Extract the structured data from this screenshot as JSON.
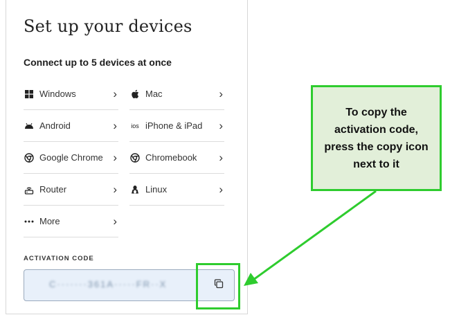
{
  "setup": {
    "title": "Set up your devices",
    "subtitle": "Connect up to 5 devices at once"
  },
  "devices": [
    {
      "label": "Windows",
      "icon": "windows-icon"
    },
    {
      "label": "Mac",
      "icon": "apple-icon"
    },
    {
      "label": "Android",
      "icon": "android-icon"
    },
    {
      "label": "iPhone & iPad",
      "icon": "ios-icon",
      "icon_text": "ios"
    },
    {
      "label": "Google Chrome",
      "icon": "chrome-icon"
    },
    {
      "label": "Chromebook",
      "icon": "chrome-icon"
    },
    {
      "label": "Router",
      "icon": "router-icon"
    },
    {
      "label": "Linux",
      "icon": "linux-icon"
    },
    {
      "label": "More",
      "icon": "more-icon"
    }
  ],
  "activation": {
    "label": "ACTIVATION CODE",
    "code": "C·······361A·····FR··X",
    "copy_icon": "copy-icon"
  },
  "annotation": {
    "text": "To copy the activation code, press the copy icon next to it",
    "color": "#2ecc2e",
    "bg": "#e2efd9"
  }
}
